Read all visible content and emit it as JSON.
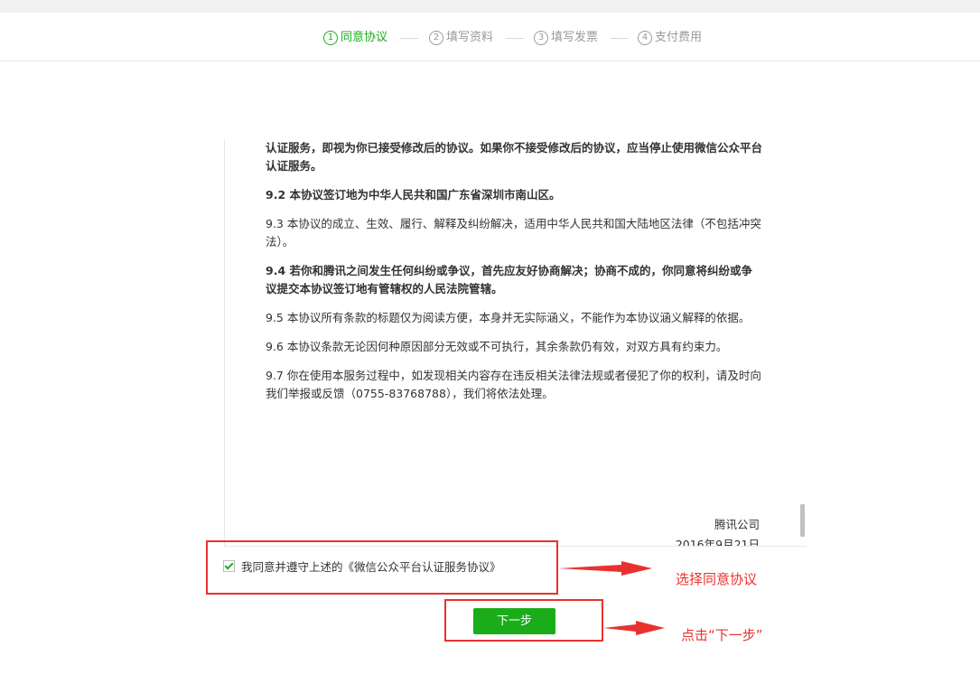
{
  "steps": [
    {
      "num": "1",
      "label": "同意协议"
    },
    {
      "num": "2",
      "label": "填写资料"
    },
    {
      "num": "3",
      "label": "填写发票"
    },
    {
      "num": "4",
      "label": "支付费用"
    }
  ],
  "agreement": {
    "p1": "认证服务，即视为你已接受修改后的协议。如果你不接受修改后的协议，应当停止使用微信公众平台认证服务。",
    "p2": "9.2 本协议签订地为中华人民共和国广东省深圳市南山区。",
    "p3": "9.3 本协议的成立、生效、履行、解释及纠纷解决，适用中华人民共和国大陆地区法律（不包括冲突法）。",
    "p4": "9.4 若你和腾讯之间发生任何纠纷或争议，首先应友好协商解决；协商不成的，你同意将纠纷或争议提交本协议签订地有管辖权的人民法院管辖。",
    "p5": "9.5 本协议所有条款的标题仅为阅读方便，本身并无实际涵义，不能作为本协议涵义解释的依据。",
    "p6": "9.6 本协议条款无论因何种原因部分无效或不可执行，其余条款仍有效，对双方具有约束力。",
    "p7": "9.7 你在使用本服务过程中，如发现相关内容存在违反相关法律法规或者侵犯了你的权利，请及时向我们举报或反馈（0755-83768788），我们将依法处理。",
    "company": "腾讯公司",
    "date": "2016年9月21日"
  },
  "agree_label": "我同意并遵守上述的《微信公众平台认证服务协议》",
  "agree_checked": true,
  "next_label": "下一步",
  "annotations": {
    "select_agreement": "选择同意协议",
    "click_next": "点击“下一步”"
  },
  "colors": {
    "accent_green": "#1aad19",
    "annotation_red": "#e8322f",
    "inactive_gray": "#9a9a9a"
  }
}
